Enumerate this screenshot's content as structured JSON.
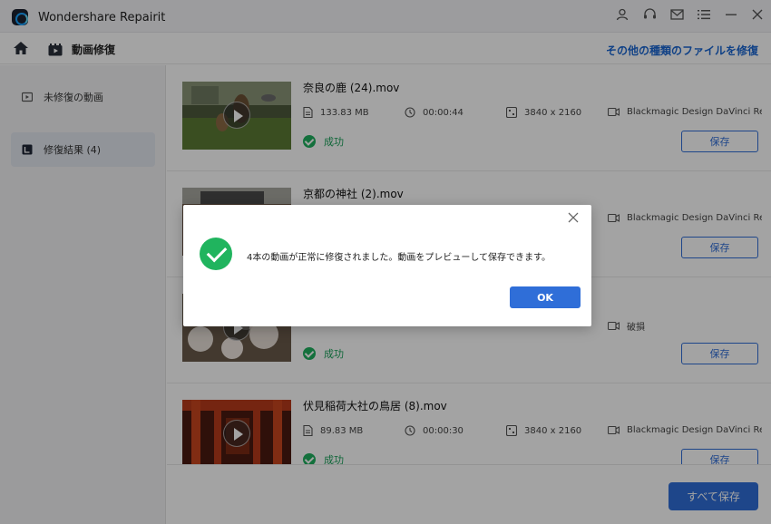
{
  "app": {
    "title": "Wondershare Repairit"
  },
  "header": {
    "page_title": "動画修復",
    "other_files_link": "その他の種類のファイルを修復"
  },
  "sidebar": {
    "items": [
      {
        "label": "未修復の動画"
      },
      {
        "label": "修復結果 (4)"
      }
    ]
  },
  "rows": [
    {
      "filename": "奈良の鹿 (24).mov",
      "size": "133.83  MB",
      "duration": "00:00:44",
      "resolution": "3840 x 2160",
      "device": "Blackmagic Design DaVinci Re...",
      "status": "成功",
      "save_label": "保存"
    },
    {
      "filename": "京都の神社 (2).mov",
      "size": "",
      "duration": "",
      "resolution": "",
      "device": "Blackmagic Design DaVinci Re...",
      "status": "",
      "save_label": "保存"
    },
    {
      "filename": "",
      "size": "",
      "duration": "",
      "resolution": "",
      "device": "破損",
      "status": "成功",
      "save_label": "保存"
    },
    {
      "filename": "伏見稲荷大社の鳥居 (8).mov",
      "size": "89.83  MB",
      "duration": "00:00:30",
      "resolution": "3840 x 2160",
      "device": "Blackmagic Design DaVinci Re...",
      "status": "成功",
      "save_label": "保存"
    }
  ],
  "footer": {
    "save_all_label": "すべて保存"
  },
  "dialog": {
    "message": "4本の動画が正常に修復されました。動画をプレビューして保存できます。",
    "ok_label": "OK"
  },
  "colors": {
    "accent": "#2f6ed8",
    "success": "#1fb05f",
    "link": "#1a66d2"
  }
}
